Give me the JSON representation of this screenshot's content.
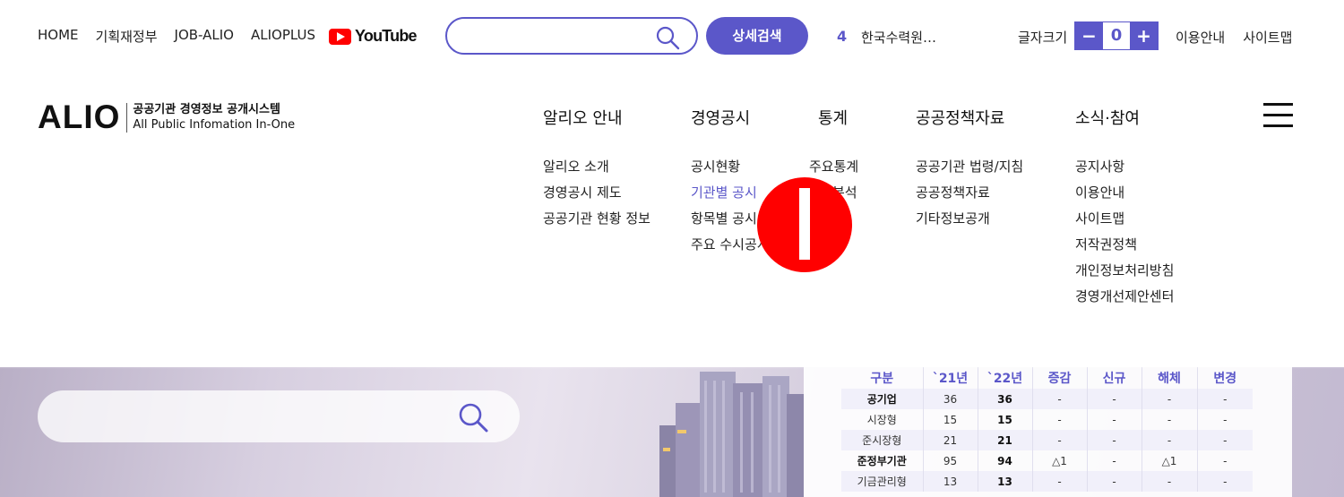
{
  "topbar": {
    "links": [
      "HOME",
      "기획재정부",
      "JOB-ALIO",
      "ALIOPLUS"
    ],
    "youtube": "YouTube",
    "search": {
      "value": "",
      "placeholder": ""
    },
    "detail_search": "상세검색",
    "ranking": {
      "number": "4",
      "text": "한국수력원…"
    },
    "font_size": {
      "label": "글자크기",
      "minus": "−",
      "value": "0",
      "plus": "+"
    },
    "right_links": [
      "이용안내",
      "사이트맵"
    ]
  },
  "logo": {
    "main": "ALIO",
    "line1": "공공기관 경영정보 공개시스템",
    "line2": "All Public Infomation In-One"
  },
  "gnb": [
    {
      "label": "알리오 안내",
      "items": [
        "알리오 소개",
        "경영공시 제도",
        "공공기관 현황 정보"
      ]
    },
    {
      "label": "경영공시",
      "items": [
        "공시현황",
        "기관별 공시",
        "항목별 공시",
        "주요 수시공시"
      ]
    },
    {
      "label": "통계",
      "items": [
        "주요통계",
        "분석"
      ]
    },
    {
      "label": "공공정책자료",
      "items": [
        "공공기관 법령/지침",
        "공공정책자료",
        "기타정보공개"
      ]
    },
    {
      "label": "소식·참여",
      "items": [
        "공지사항",
        "이용안내",
        "사이트맵",
        "저작권정책",
        "개인정보처리방침",
        "경영개선제안센터"
      ]
    }
  ],
  "hero": {
    "search": {
      "value": "",
      "placeholder": ""
    }
  },
  "stats": {
    "headers": [
      "구분",
      "`21년",
      "`22년",
      "증감",
      "신규",
      "해체",
      "변경"
    ],
    "rows": [
      [
        "공기업",
        "36",
        "36",
        "-",
        "-",
        "-",
        "-"
      ],
      [
        "시장형",
        "15",
        "15",
        "-",
        "-",
        "-",
        "-"
      ],
      [
        "준시장형",
        "21",
        "21",
        "-",
        "-",
        "-",
        "-"
      ],
      [
        "준정부기관",
        "95",
        "94",
        "△1",
        "-",
        "△1",
        "-"
      ],
      [
        "기금관리형",
        "13",
        "13",
        "-",
        "-",
        "-",
        "-"
      ]
    ]
  },
  "colors": {
    "accent": "#5b57c9",
    "youtube": "#ff0000",
    "cursor": "#ff0000"
  }
}
